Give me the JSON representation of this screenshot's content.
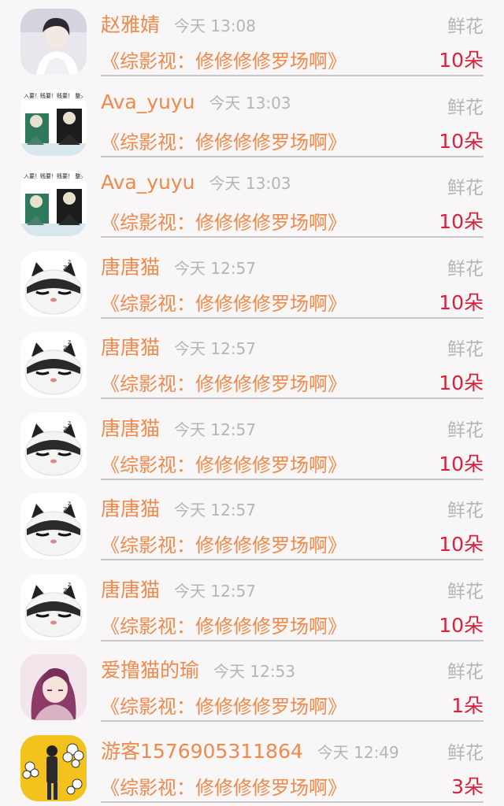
{
  "rows": [
    {
      "name": "赵雅婧",
      "time": "今天 13:08",
      "gift": "鲜花",
      "book": "《综影视：修修修修罗场啊》",
      "count": "10朵",
      "avatar": "portrait-photo"
    },
    {
      "name": "Ava_yuyu",
      "time": "今天 13:03",
      "gift": "鲜花",
      "book": "《综影视：修修修修罗场啊》",
      "count": "10朵",
      "avatar": "meme-comic",
      "meme_text": "入要！贱要！贱要！ 整天就知道贱要"
    },
    {
      "name": "Ava_yuyu",
      "time": "今天 13:03",
      "gift": "鲜花",
      "book": "《综影视：修修修修罗场啊》",
      "count": "10朵",
      "avatar": "meme-comic",
      "meme_text": "入要！贱要！贱要！ 整天就知道贱要"
    },
    {
      "name": "唐唐猫",
      "time": "今天 12:57",
      "gift": "鲜花",
      "book": "《综影视：修修修修罗场啊》",
      "count": "10朵",
      "avatar": "sleepy-cat"
    },
    {
      "name": "唐唐猫",
      "time": "今天 12:57",
      "gift": "鲜花",
      "book": "《综影视：修修修修罗场啊》",
      "count": "10朵",
      "avatar": "sleepy-cat"
    },
    {
      "name": "唐唐猫",
      "time": "今天 12:57",
      "gift": "鲜花",
      "book": "《综影视：修修修修罗场啊》",
      "count": "10朵",
      "avatar": "sleepy-cat"
    },
    {
      "name": "唐唐猫",
      "time": "今天 12:57",
      "gift": "鲜花",
      "book": "《综影视：修修修修罗场啊》",
      "count": "10朵",
      "avatar": "sleepy-cat"
    },
    {
      "name": "唐唐猫",
      "time": "今天 12:57",
      "gift": "鲜花",
      "book": "《综影视：修修修修罗场啊》",
      "count": "10朵",
      "avatar": "sleepy-cat"
    },
    {
      "name": "爱撸猫的瑜",
      "time": "今天 12:53",
      "gift": "鲜花",
      "book": "《综影视：修修修修罗场啊》",
      "count": "1朵",
      "avatar": "anime-girl"
    },
    {
      "name": "游客1576905311864",
      "time": "今天 12:49",
      "gift": "鲜花",
      "book": "《综影视：修修修修罗场啊》",
      "count": "3朵",
      "avatar": "flower-figure"
    }
  ],
  "colors": {
    "accent_orange": "#f08a4c",
    "count_red": "#d9213c",
    "muted_gray": "#b5b5b5",
    "background": "#f8f6f6"
  }
}
